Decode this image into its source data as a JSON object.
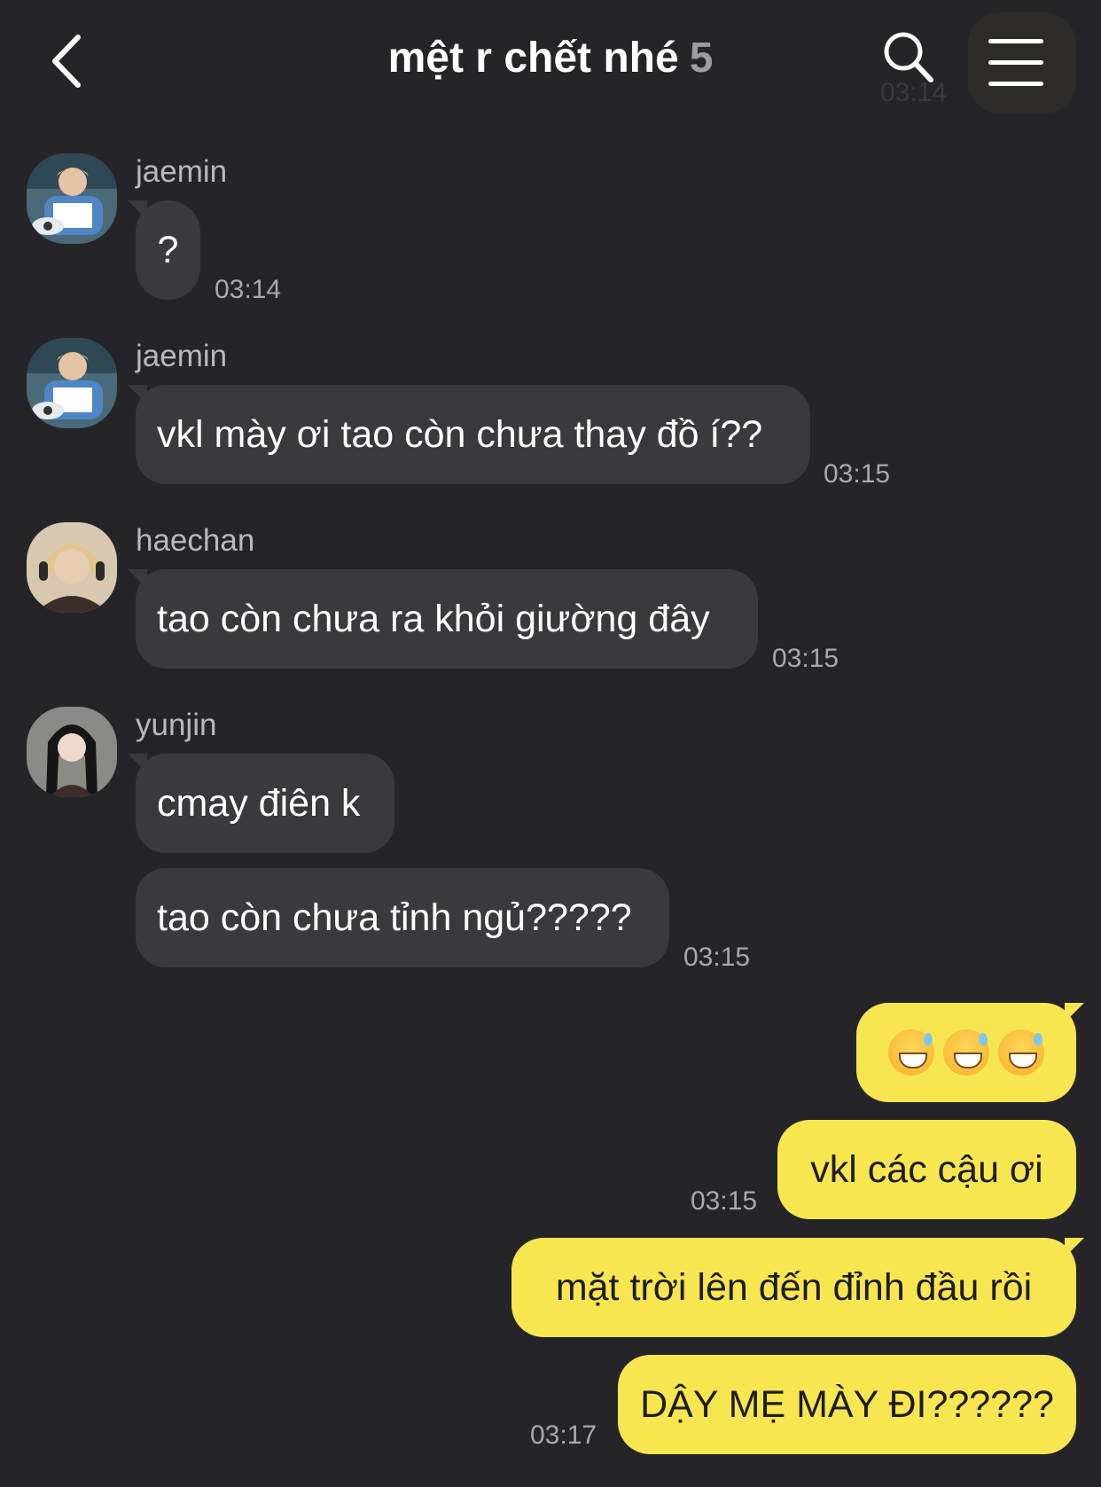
{
  "header": {
    "title": "mệt r chết nhé",
    "member_count": "5",
    "ghost_time": "03:14"
  },
  "messages": [
    {
      "sender": "jaemin",
      "texts": [
        "?"
      ],
      "time": "03:14"
    },
    {
      "sender": "jaemin",
      "texts": [
        "vkl mày ơi tao còn chưa thay đồ í??"
      ],
      "time": "03:15"
    },
    {
      "sender": "haechan",
      "texts": [
        "tao còn chưa ra khỏi giường đây"
      ],
      "time": "03:15"
    },
    {
      "sender": "yunjin",
      "texts": [
        "cmay điên k",
        "tao còn chưa tỉnh ngủ?????"
      ],
      "time": "03:15"
    }
  ],
  "my_messages": [
    {
      "emoji": [
        "grinning-face-with-sweat",
        "grinning-face-with-sweat",
        "grinning-face-with-sweat"
      ]
    },
    {
      "text": "vkl các cậu ơi",
      "time": "03:15"
    },
    {
      "text": "mặt trời lên đến đỉnh đầu rồi"
    },
    {
      "text": "DẬY MẸ MÀY ĐI??????",
      "time": "03:17"
    }
  ],
  "colors": {
    "background": "#252529",
    "incoming_bubble": "#3a3a3e",
    "outgoing_bubble": "#f8e650"
  }
}
